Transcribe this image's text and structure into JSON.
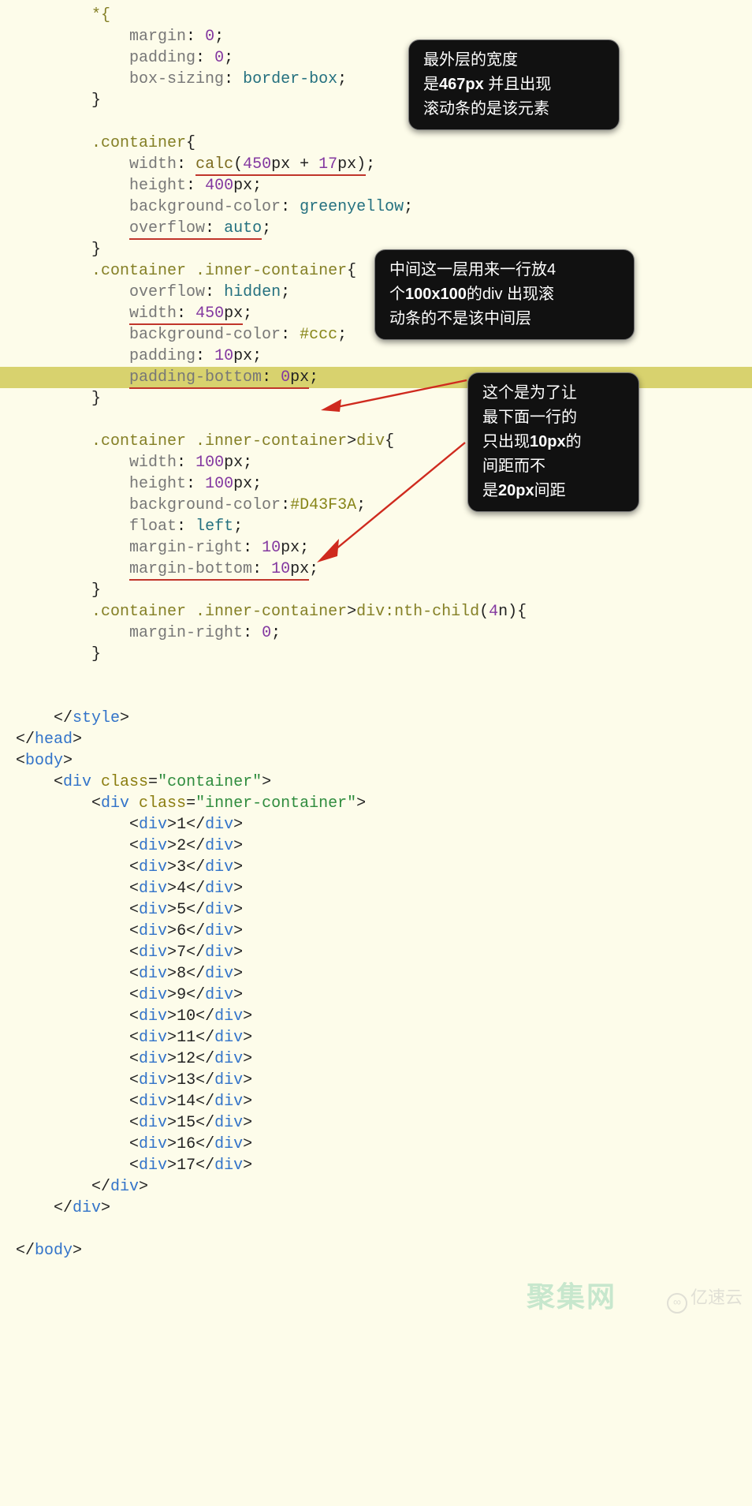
{
  "lines": [
    [
      [
        "        ",
        ""
      ],
      [
        "*{",
        "sel"
      ]
    ],
    [
      [
        "            ",
        ""
      ],
      [
        "margin",
        "prop"
      ],
      [
        ": ",
        ""
      ],
      [
        "0",
        "num"
      ],
      [
        ";",
        ""
      ]
    ],
    [
      [
        "            ",
        ""
      ],
      [
        "padding",
        "prop"
      ],
      [
        ": ",
        ""
      ],
      [
        "0",
        "num"
      ],
      [
        ";",
        ""
      ]
    ],
    [
      [
        "            ",
        ""
      ],
      [
        "box-sizing",
        "prop"
      ],
      [
        ": ",
        ""
      ],
      [
        "border-box",
        "val"
      ],
      [
        ";",
        ""
      ]
    ],
    [
      [
        "        }",
        ""
      ]
    ],
    [
      [
        "",
        ""
      ]
    ],
    [
      [
        "        ",
        ""
      ],
      [
        ".container",
        "sel"
      ],
      [
        "{",
        ""
      ]
    ],
    [
      [
        "            ",
        ""
      ],
      [
        "width",
        "prop"
      ],
      [
        ": ",
        ""
      ],
      [
        "calc",
        "fn",
        true
      ],
      [
        "(",
        "",
        true
      ],
      [
        "450",
        "num",
        true
      ],
      [
        "px + ",
        "",
        true
      ],
      [
        "17",
        "num",
        true
      ],
      [
        "px)",
        "",
        true
      ],
      [
        ";",
        ""
      ]
    ],
    [
      [
        "            ",
        ""
      ],
      [
        "height",
        "prop"
      ],
      [
        ": ",
        ""
      ],
      [
        "400",
        "num"
      ],
      [
        "px;",
        ""
      ]
    ],
    [
      [
        "            ",
        ""
      ],
      [
        "background-color",
        "prop"
      ],
      [
        ": ",
        ""
      ],
      [
        "greenyellow",
        "val"
      ],
      [
        ";",
        ""
      ]
    ],
    [
      [
        "            ",
        ""
      ],
      [
        "overflow",
        "prop",
        true
      ],
      [
        ": ",
        "",
        true
      ],
      [
        "auto",
        "val",
        true
      ],
      [
        ";",
        ""
      ]
    ],
    [
      [
        "        }",
        ""
      ]
    ],
    [
      [
        "        ",
        ""
      ],
      [
        ".container .inner-container",
        "sel"
      ],
      [
        "{",
        ""
      ]
    ],
    [
      [
        "            ",
        ""
      ],
      [
        "overflow",
        "prop"
      ],
      [
        ": ",
        ""
      ],
      [
        "hidden",
        "val"
      ],
      [
        ";",
        ""
      ]
    ],
    [
      [
        "            ",
        ""
      ],
      [
        "width",
        "prop",
        true
      ],
      [
        ": ",
        "",
        true
      ],
      [
        "450",
        "num",
        true
      ],
      [
        "px",
        "",
        true
      ],
      [
        ";",
        ""
      ]
    ],
    [
      [
        "            ",
        ""
      ],
      [
        "background-color",
        "prop"
      ],
      [
        ": ",
        ""
      ],
      [
        "#ccc",
        "hex"
      ],
      [
        ";",
        ""
      ]
    ],
    [
      [
        "            ",
        ""
      ],
      [
        "padding",
        "prop"
      ],
      [
        ": ",
        ""
      ],
      [
        "10",
        "num"
      ],
      [
        "px;",
        ""
      ]
    ],
    [
      [
        "            ",
        ""
      ],
      [
        "padding-bottom",
        "prop",
        true,
        "hl"
      ],
      [
        ": ",
        "",
        true,
        "hl"
      ],
      [
        "0",
        "num",
        true,
        "hl"
      ],
      [
        "px",
        "",
        true,
        "hl"
      ],
      [
        ";",
        "",
        false,
        "hl"
      ]
    ],
    [
      [
        "        }",
        ""
      ]
    ],
    [
      [
        "",
        ""
      ]
    ],
    [
      [
        "        ",
        ""
      ],
      [
        ".container .inner-container",
        "sel"
      ],
      [
        ">",
        ""
      ],
      [
        "div",
        "sel"
      ],
      [
        "{",
        ""
      ]
    ],
    [
      [
        "            ",
        ""
      ],
      [
        "width",
        "prop"
      ],
      [
        ": ",
        ""
      ],
      [
        "100",
        "num"
      ],
      [
        "px;",
        ""
      ]
    ],
    [
      [
        "            ",
        ""
      ],
      [
        "height",
        "prop"
      ],
      [
        ": ",
        ""
      ],
      [
        "100",
        "num"
      ],
      [
        "px;",
        ""
      ]
    ],
    [
      [
        "            ",
        ""
      ],
      [
        "background-color",
        "prop"
      ],
      [
        ":",
        ""
      ],
      [
        "#D43F3A",
        "hex"
      ],
      [
        ";",
        ""
      ]
    ],
    [
      [
        "            ",
        ""
      ],
      [
        "float",
        "prop"
      ],
      [
        ": ",
        ""
      ],
      [
        "left",
        "val"
      ],
      [
        ";",
        ""
      ]
    ],
    [
      [
        "            ",
        ""
      ],
      [
        "margin-right",
        "prop"
      ],
      [
        ": ",
        ""
      ],
      [
        "10",
        "num"
      ],
      [
        "px;",
        ""
      ]
    ],
    [
      [
        "            ",
        ""
      ],
      [
        "margin-bottom",
        "prop",
        true
      ],
      [
        ": ",
        "",
        true
      ],
      [
        "10",
        "num",
        true
      ],
      [
        "px",
        "",
        true
      ],
      [
        ";",
        ""
      ]
    ],
    [
      [
        "        }",
        ""
      ]
    ],
    [
      [
        "        ",
        ""
      ],
      [
        ".container .inner-container",
        "sel"
      ],
      [
        ">",
        ""
      ],
      [
        "div:nth-child",
        "sel"
      ],
      [
        "(",
        ""
      ],
      [
        "4",
        "num"
      ],
      [
        "n){",
        ""
      ]
    ],
    [
      [
        "            ",
        ""
      ],
      [
        "margin-right",
        "prop"
      ],
      [
        ": ",
        ""
      ],
      [
        "0",
        "num"
      ],
      [
        ";",
        ""
      ]
    ],
    [
      [
        "        }",
        ""
      ]
    ],
    [
      [
        "",
        ""
      ]
    ],
    [
      [
        "",
        ""
      ]
    ],
    [
      [
        "    </",
        ""
      ],
      [
        "style",
        "tag"
      ],
      [
        ">",
        ""
      ]
    ],
    [
      [
        "</",
        ""
      ],
      [
        "head",
        "tag"
      ],
      [
        ">",
        ""
      ]
    ],
    [
      [
        "<",
        ""
      ],
      [
        "body",
        "tag"
      ],
      [
        ">",
        ""
      ]
    ],
    [
      [
        "    <",
        ""
      ],
      [
        "div ",
        "tag"
      ],
      [
        "class",
        "attr"
      ],
      [
        "=",
        ""
      ],
      [
        "\"container\"",
        "str"
      ],
      [
        ">",
        ""
      ]
    ],
    [
      [
        "        <",
        ""
      ],
      [
        "div ",
        "tag"
      ],
      [
        "class",
        "attr"
      ],
      [
        "=",
        ""
      ],
      [
        "\"inner-container\"",
        "str"
      ],
      [
        ">",
        ""
      ]
    ],
    [
      [
        "            <",
        ""
      ],
      [
        "div",
        "tag"
      ],
      [
        ">",
        ""
      ],
      [
        "1",
        "txt"
      ],
      [
        "</",
        ""
      ],
      [
        "div",
        "tag"
      ],
      [
        ">",
        ""
      ]
    ],
    [
      [
        "            <",
        ""
      ],
      [
        "div",
        "tag"
      ],
      [
        ">",
        ""
      ],
      [
        "2",
        "txt"
      ],
      [
        "</",
        ""
      ],
      [
        "div",
        "tag"
      ],
      [
        ">",
        ""
      ]
    ],
    [
      [
        "            <",
        ""
      ],
      [
        "div",
        "tag"
      ],
      [
        ">",
        ""
      ],
      [
        "3",
        "txt"
      ],
      [
        "</",
        ""
      ],
      [
        "div",
        "tag"
      ],
      [
        ">",
        ""
      ]
    ],
    [
      [
        "            <",
        ""
      ],
      [
        "div",
        "tag"
      ],
      [
        ">",
        ""
      ],
      [
        "4",
        "txt"
      ],
      [
        "</",
        ""
      ],
      [
        "div",
        "tag"
      ],
      [
        ">",
        ""
      ]
    ],
    [
      [
        "            <",
        ""
      ],
      [
        "div",
        "tag"
      ],
      [
        ">",
        ""
      ],
      [
        "5",
        "txt"
      ],
      [
        "</",
        ""
      ],
      [
        "div",
        "tag"
      ],
      [
        ">",
        ""
      ]
    ],
    [
      [
        "            <",
        ""
      ],
      [
        "div",
        "tag"
      ],
      [
        ">",
        ""
      ],
      [
        "6",
        "txt"
      ],
      [
        "</",
        ""
      ],
      [
        "div",
        "tag"
      ],
      [
        ">",
        ""
      ]
    ],
    [
      [
        "            <",
        ""
      ],
      [
        "div",
        "tag"
      ],
      [
        ">",
        ""
      ],
      [
        "7",
        "txt"
      ],
      [
        "</",
        ""
      ],
      [
        "div",
        "tag"
      ],
      [
        ">",
        ""
      ]
    ],
    [
      [
        "            <",
        ""
      ],
      [
        "div",
        "tag"
      ],
      [
        ">",
        ""
      ],
      [
        "8",
        "txt"
      ],
      [
        "</",
        ""
      ],
      [
        "div",
        "tag"
      ],
      [
        ">",
        ""
      ]
    ],
    [
      [
        "            <",
        ""
      ],
      [
        "div",
        "tag"
      ],
      [
        ">",
        ""
      ],
      [
        "9",
        "txt"
      ],
      [
        "</",
        ""
      ],
      [
        "div",
        "tag"
      ],
      [
        ">",
        ""
      ]
    ],
    [
      [
        "            <",
        ""
      ],
      [
        "div",
        "tag"
      ],
      [
        ">",
        ""
      ],
      [
        "10",
        "txt"
      ],
      [
        "</",
        ""
      ],
      [
        "div",
        "tag"
      ],
      [
        ">",
        ""
      ]
    ],
    [
      [
        "            <",
        ""
      ],
      [
        "div",
        "tag"
      ],
      [
        ">",
        ""
      ],
      [
        "11",
        "txt"
      ],
      [
        "</",
        ""
      ],
      [
        "div",
        "tag"
      ],
      [
        ">",
        ""
      ]
    ],
    [
      [
        "            <",
        ""
      ],
      [
        "div",
        "tag"
      ],
      [
        ">",
        ""
      ],
      [
        "12",
        "txt"
      ],
      [
        "</",
        ""
      ],
      [
        "div",
        "tag"
      ],
      [
        ">",
        ""
      ]
    ],
    [
      [
        "            <",
        ""
      ],
      [
        "div",
        "tag"
      ],
      [
        ">",
        ""
      ],
      [
        "13",
        "txt"
      ],
      [
        "</",
        ""
      ],
      [
        "div",
        "tag"
      ],
      [
        ">",
        ""
      ]
    ],
    [
      [
        "            <",
        ""
      ],
      [
        "div",
        "tag"
      ],
      [
        ">",
        ""
      ],
      [
        "14",
        "txt"
      ],
      [
        "</",
        ""
      ],
      [
        "div",
        "tag"
      ],
      [
        ">",
        ""
      ]
    ],
    [
      [
        "            <",
        ""
      ],
      [
        "div",
        "tag"
      ],
      [
        ">",
        ""
      ],
      [
        "15",
        "txt"
      ],
      [
        "</",
        ""
      ],
      [
        "div",
        "tag"
      ],
      [
        ">",
        ""
      ]
    ],
    [
      [
        "            <",
        ""
      ],
      [
        "div",
        "tag"
      ],
      [
        ">",
        ""
      ],
      [
        "16",
        "txt"
      ],
      [
        "</",
        ""
      ],
      [
        "div",
        "tag"
      ],
      [
        ">",
        ""
      ]
    ],
    [
      [
        "            <",
        ""
      ],
      [
        "div",
        "tag"
      ],
      [
        ">",
        ""
      ],
      [
        "17",
        "txt"
      ],
      [
        "</",
        ""
      ],
      [
        "div",
        "tag"
      ],
      [
        ">",
        ""
      ]
    ],
    [
      [
        "        </",
        ""
      ],
      [
        "div",
        "tag"
      ],
      [
        ">",
        ""
      ]
    ],
    [
      [
        "    </",
        ""
      ],
      [
        "div",
        "tag"
      ],
      [
        ">",
        ""
      ]
    ],
    [
      [
        "",
        ""
      ]
    ],
    [
      [
        "</",
        ""
      ],
      [
        "body",
        "tag"
      ],
      [
        ">",
        ""
      ]
    ]
  ],
  "notes": {
    "n1": {
      "l1": "最外层的宽度",
      "l2a": "是",
      "l2b": "467px",
      "l2c": " 并且出现",
      "l3": "滚动条的是该元素"
    },
    "n2": {
      "l1": "中间这一层用来一行放4",
      "l2a": "个",
      "l2b": "100x100",
      "l2c": "的div  出现滚",
      "l3": "动条的不是该中间层"
    },
    "n3": {
      "l1": "这个是为了让",
      "l2": "最下面一行的",
      "l3a": "只出现",
      "l3b": "10px",
      "l3c": "的",
      "l4": "间距而不",
      "l5a": "是",
      "l5b": "20px",
      "l5c": "间距"
    }
  },
  "watermark": {
    "left": "聚集网",
    "right": "亿速云"
  }
}
